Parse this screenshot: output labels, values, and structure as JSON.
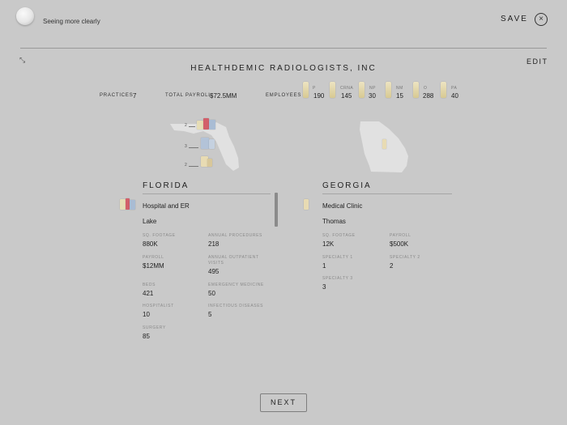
{
  "header": {
    "tagline": "Seeing more clearly",
    "save_label": "SAVE",
    "close_icon": "×",
    "edit_label": "EDIT",
    "collapse_icon": "⤡"
  },
  "company_name": "HEALTHDEMIC RADIOLOGISTS, INC",
  "stats": {
    "practices_label": "PRACTICES",
    "practices_value": "7",
    "payroll_label": "TOTAL PAYROLL",
    "payroll_value": "$72.5MM",
    "employees_label": "EMPLOYEES",
    "employees": [
      {
        "code": "P",
        "value": "190"
      },
      {
        "code": "CRNA",
        "value": "145"
      },
      {
        "code": "NP",
        "value": "30"
      },
      {
        "code": "NM",
        "value": "15"
      },
      {
        "code": "O",
        "value": "288"
      },
      {
        "code": "PA",
        "value": "40"
      }
    ]
  },
  "map_pins": {
    "fl_1": "2",
    "fl_2": "3",
    "fl_3": "2"
  },
  "florida": {
    "title": "FLORIDA",
    "type": "Hospital and ER",
    "county": "Lake",
    "fields": {
      "sq_footage": {
        "label": "SQ. FOOTAGE",
        "value": "880K"
      },
      "annual_procedures": {
        "label": "ANNUAL PROCEDURES",
        "value": "218"
      },
      "payroll": {
        "label": "PAYROLL",
        "value": "$12MM"
      },
      "annual_outpatient": {
        "label": "ANNUAL OUTPATIENT VISITS",
        "value": "495"
      },
      "beds": {
        "label": "BEDS",
        "value": "421"
      },
      "emergency": {
        "label": "EMERGENCY MEDICINE",
        "value": "50"
      },
      "hospitalist": {
        "label": "HOSPITALIST",
        "value": "10"
      },
      "infectious": {
        "label": "INFECTIOUS DISEASES",
        "value": "5"
      },
      "surgery": {
        "label": "SURGERY",
        "value": "85"
      }
    }
  },
  "georgia": {
    "title": "GEORGIA",
    "type": "Medical Clinic",
    "county": "Thomas",
    "fields": {
      "sq_footage": {
        "label": "SQ. FOOTAGE",
        "value": "12K"
      },
      "payroll": {
        "label": "PAYROLL",
        "value": "$500K"
      },
      "specialty1": {
        "label": "SPECIALTY 1",
        "value": "1"
      },
      "specialty2": {
        "label": "SPECIALTY 2",
        "value": "2"
      },
      "specialty3": {
        "label": "SPECIALTY 3",
        "value": "3"
      }
    }
  },
  "next_label": "NEXT"
}
